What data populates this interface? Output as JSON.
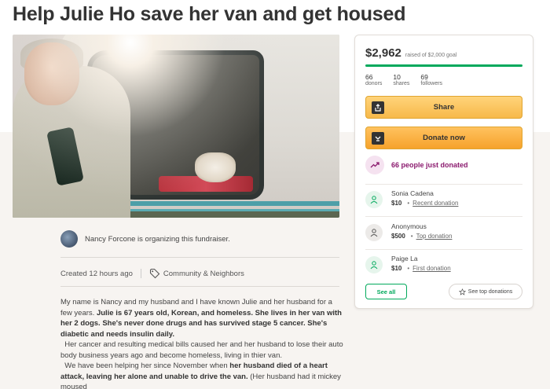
{
  "page": {
    "title": "Help Julie Ho save her van and get housed"
  },
  "organizer": {
    "text": "Nancy Forcone is organizing this fundraiser."
  },
  "meta": {
    "created": "Created 12 hours ago",
    "category": "Community & Neighbors"
  },
  "story": {
    "p1_a": "My name is Nancy  and  my husband and I have known Julie and her husband for a few years. ",
    "p1_b": "Julie is 67 years old, Korean, and homeless. She lives in her van with her 2 dogs. She's never done drugs and has survived stage 5 cancer. She's diabetic and needs insulin daily.",
    "p2": "Her cancer and resulting medical bills caused her and her husband to lose their auto body business years ago and become  homeless, living in thier van.",
    "p3_a": "We have been helping her since November when ",
    "p3_b": "her husband died of a heart attack, leaving her alone and unable to drive the van.",
    "p3_c": " (Her husband had it mickey moused"
  },
  "card": {
    "amount": "$2,962",
    "goal_text": "raised of $2,000 goal",
    "progress_fraction": 1.0,
    "stats": [
      {
        "num": "66",
        "label": "donors"
      },
      {
        "num": "10",
        "label": "shares"
      },
      {
        "num": "69",
        "label": "followers"
      }
    ],
    "share_label": "Share",
    "donate_label": "Donate now",
    "recent_text": "66 people just donated",
    "donors": [
      {
        "name": "Sonia Cadena",
        "amount": "$10",
        "type": "Recent donation",
        "avatar": "green"
      },
      {
        "name": "Anonymous",
        "amount": "$500",
        "type": "Top donation",
        "avatar": "gray"
      },
      {
        "name": "Paige La",
        "amount": "$10",
        "type": "First donation",
        "avatar": "green"
      }
    ],
    "see_all_label": "See all",
    "see_top_label": "See top donations"
  },
  "colors": {
    "brand_green": "#02a95c",
    "button_yellow": "#f7b94a",
    "recent_purple": "#8b1a6e"
  }
}
